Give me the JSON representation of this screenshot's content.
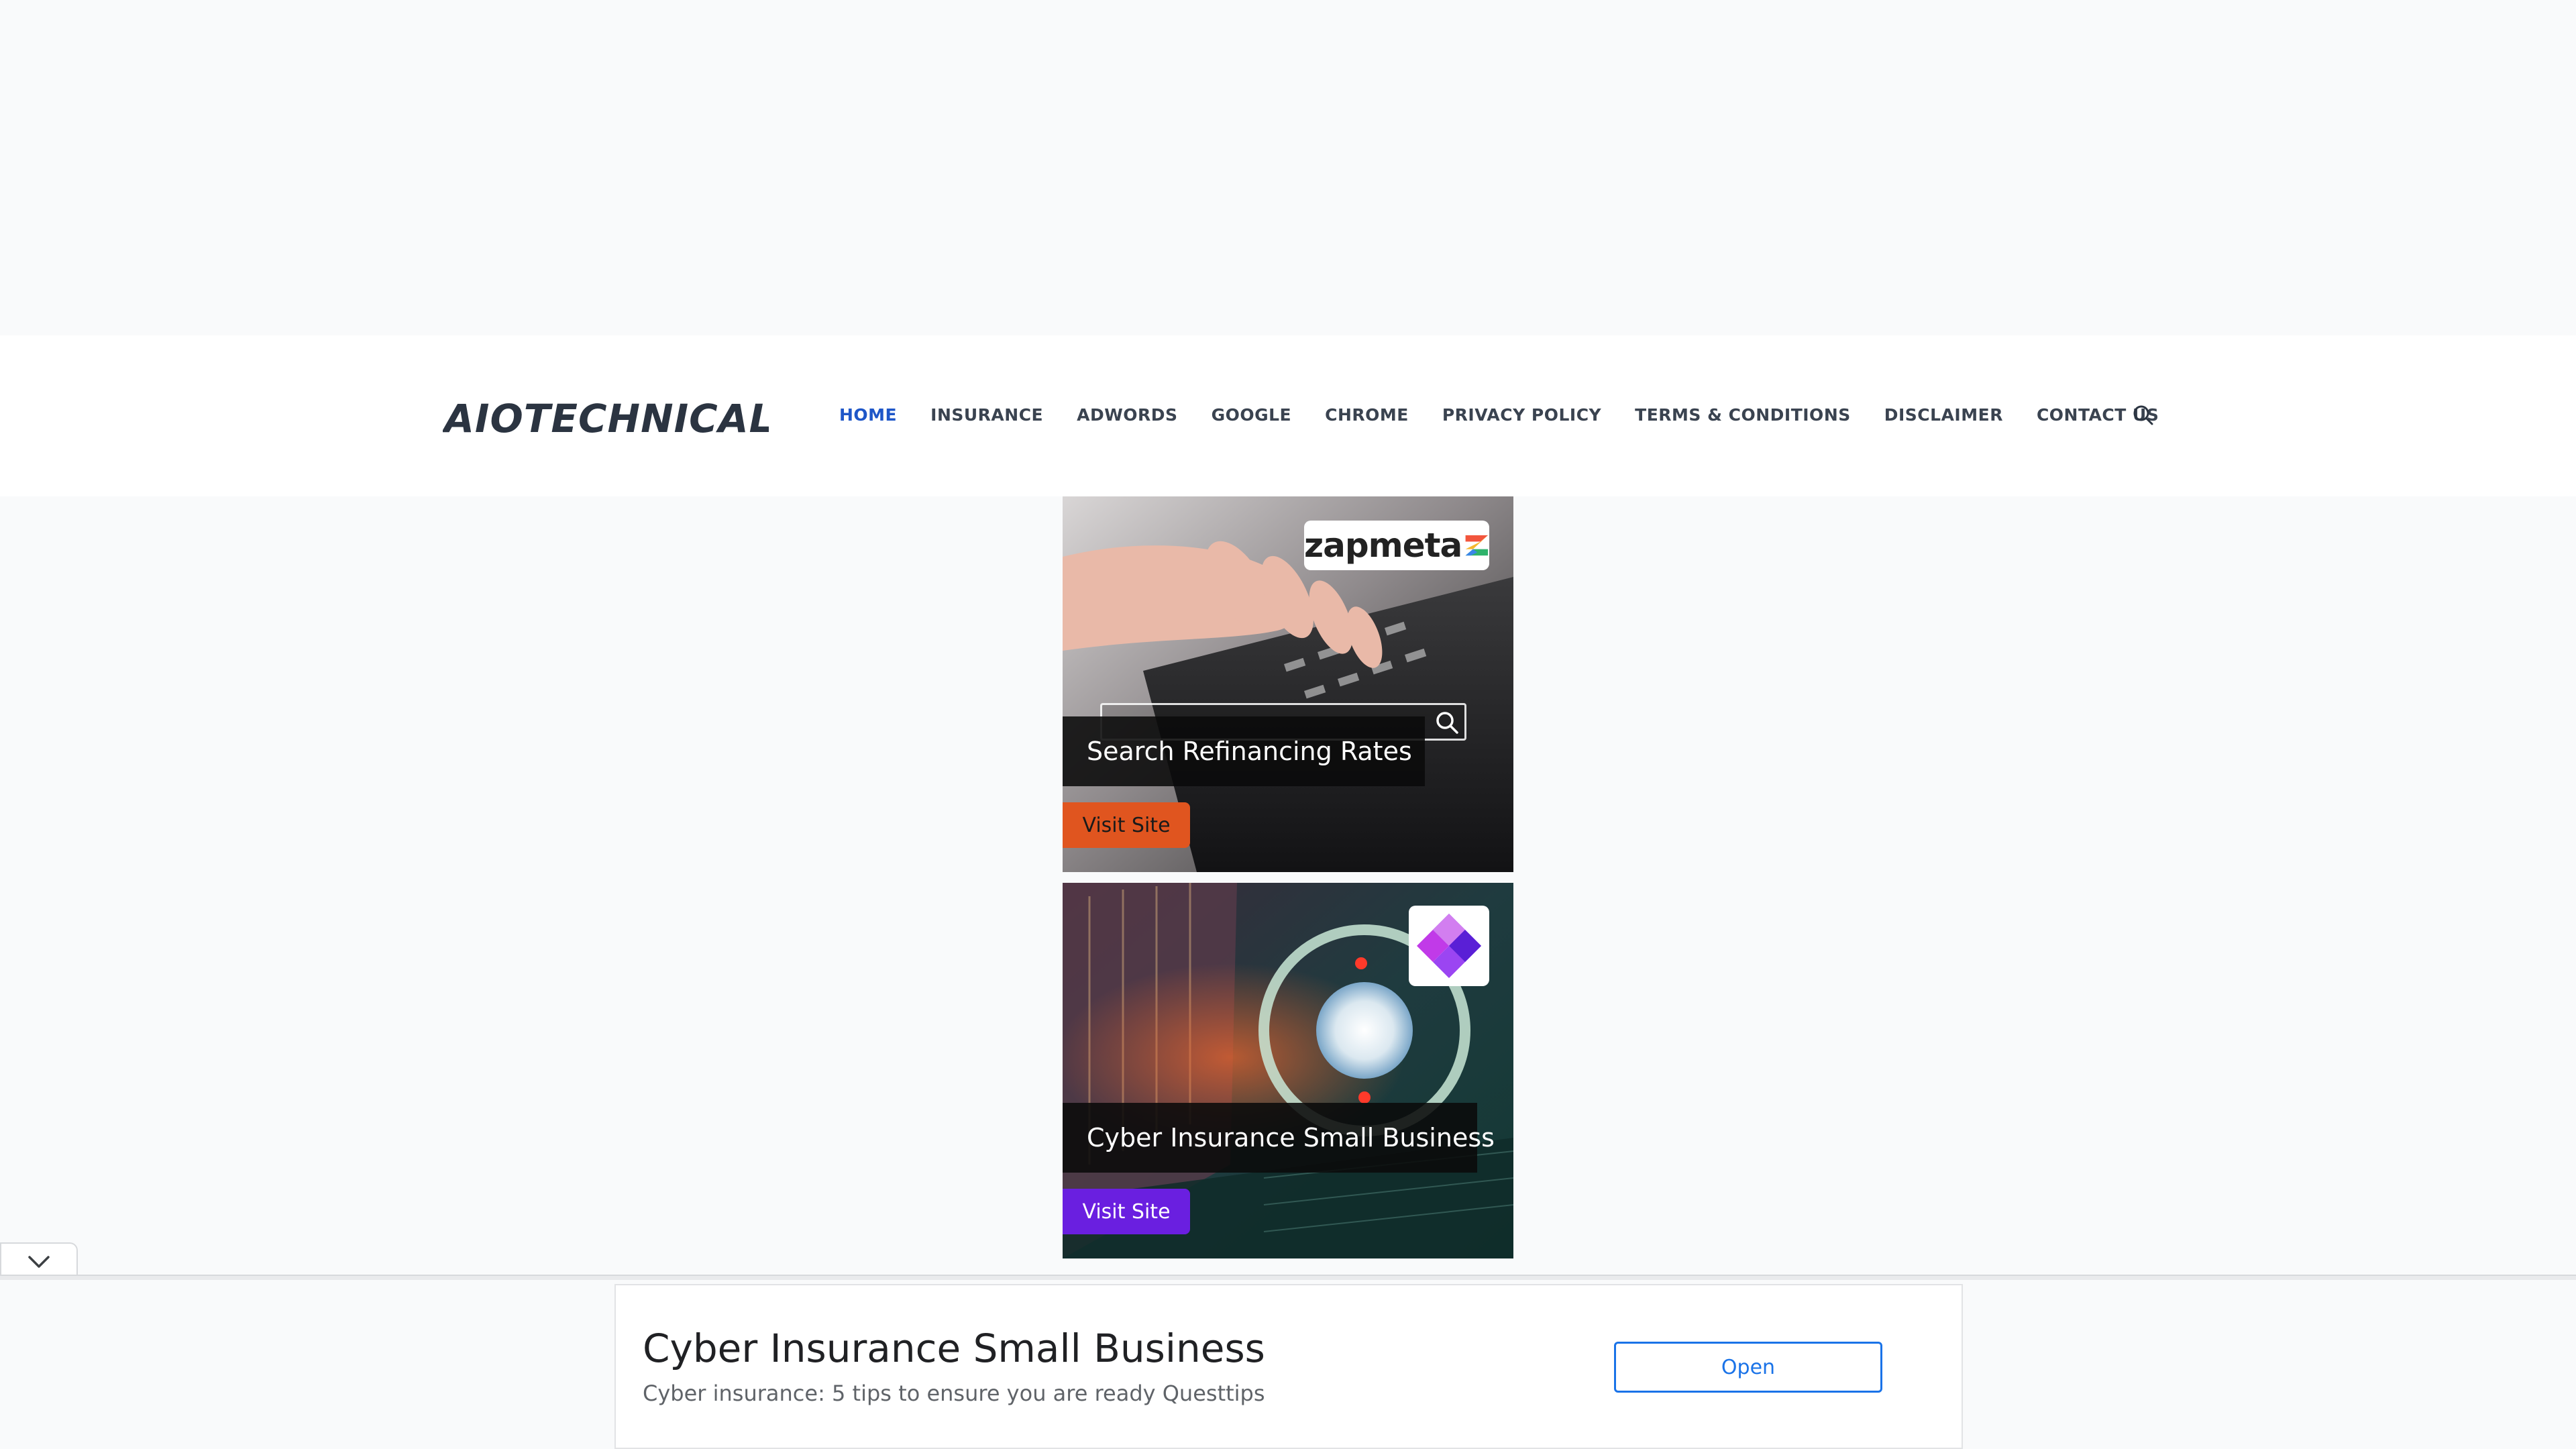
{
  "site": {
    "logo_text": "AIOTECHNICAL"
  },
  "nav": {
    "items": [
      {
        "label": "HOME",
        "active": true
      },
      {
        "label": "INSURANCE",
        "active": false
      },
      {
        "label": "ADWORDS",
        "active": false
      },
      {
        "label": "GOOGLE",
        "active": false
      },
      {
        "label": "CHROME",
        "active": false
      },
      {
        "label": "PRIVACY POLICY",
        "active": false
      },
      {
        "label": "TERMS & CONDITIONS",
        "active": false
      },
      {
        "label": "DISCLAIMER",
        "active": false
      },
      {
        "label": "CONTACT US",
        "active": false
      }
    ],
    "search_icon": "search-icon"
  },
  "ads": [
    {
      "brand": "zapmeta",
      "headline": "Search Refinancing Rates",
      "button_label": "Visit Site",
      "button_color": "#e0551f"
    },
    {
      "brand": "diamond-logo",
      "headline": "Cyber Insurance Small Business",
      "button_label": "Visit Site",
      "button_color": "#6a1fe0"
    }
  ],
  "bottom_ad": {
    "title": "Cyber Insurance Small Business",
    "description": "Cyber insurance: 5 tips to ensure you are ready Questtips",
    "button_label": "Open",
    "collapse_icon": "chevron-down-icon"
  },
  "colors": {
    "accent": "#1e56c8",
    "nav_text": "#3a4350",
    "background": "#f9fafb",
    "open_button": "#1a73e8"
  }
}
